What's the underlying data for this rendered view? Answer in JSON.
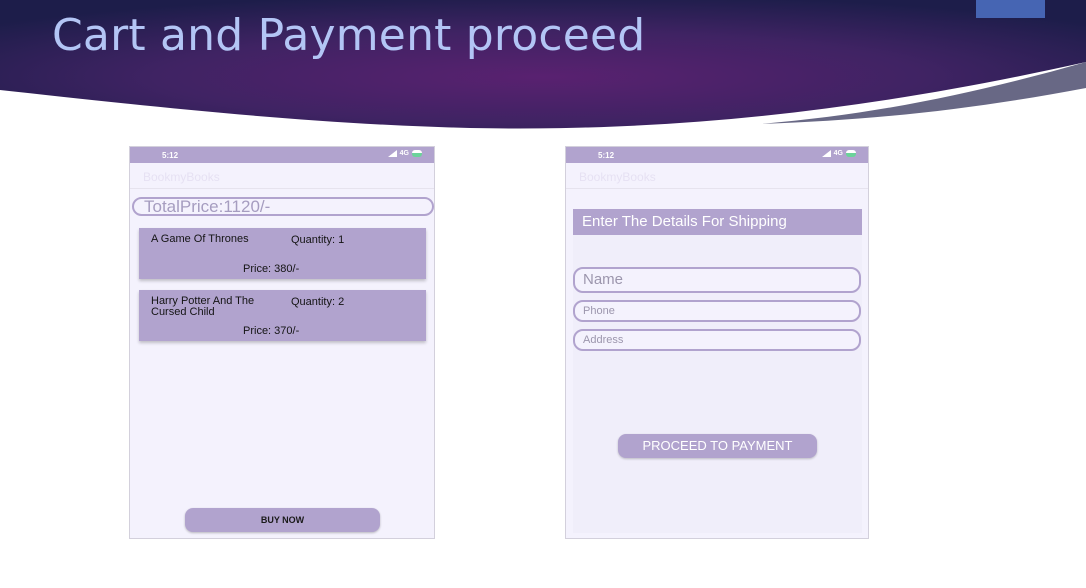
{
  "slide": {
    "title": "Cart and Payment proceed"
  },
  "colors": {
    "banner_dark": "#1d1d4a",
    "banner_mid": "#592170",
    "accent_box": "#4665b3",
    "app_primary": "#b1a3ce",
    "app_background": "#f4f2fd",
    "title_text": "#b3c5f5"
  },
  "cart_screen": {
    "status": {
      "time": "5:12",
      "network": "4G"
    },
    "app_title": "BookmyBooks",
    "total_price": "TotalPrice:1120/-",
    "items": [
      {
        "title": "A Game Of Thrones",
        "quantity": "Quantity: 1",
        "price": "Price: 380/-"
      },
      {
        "title": "Harry Potter And The Cursed Child",
        "quantity": "Quantity: 2",
        "price": "Price: 370/-"
      }
    ],
    "buy_label": "BUY NOW"
  },
  "shipping_screen": {
    "status": {
      "time": "5:12",
      "network": "4G"
    },
    "app_title": "BookmyBooks",
    "header": "Enter The Details For Shipping",
    "fields": {
      "name_placeholder": "Name",
      "phone_placeholder": "Phone",
      "address_placeholder": "Address"
    },
    "proceed_label": "PROCEED TO PAYMENT"
  },
  "icons": [
    "signal-icon",
    "battery-icon"
  ]
}
